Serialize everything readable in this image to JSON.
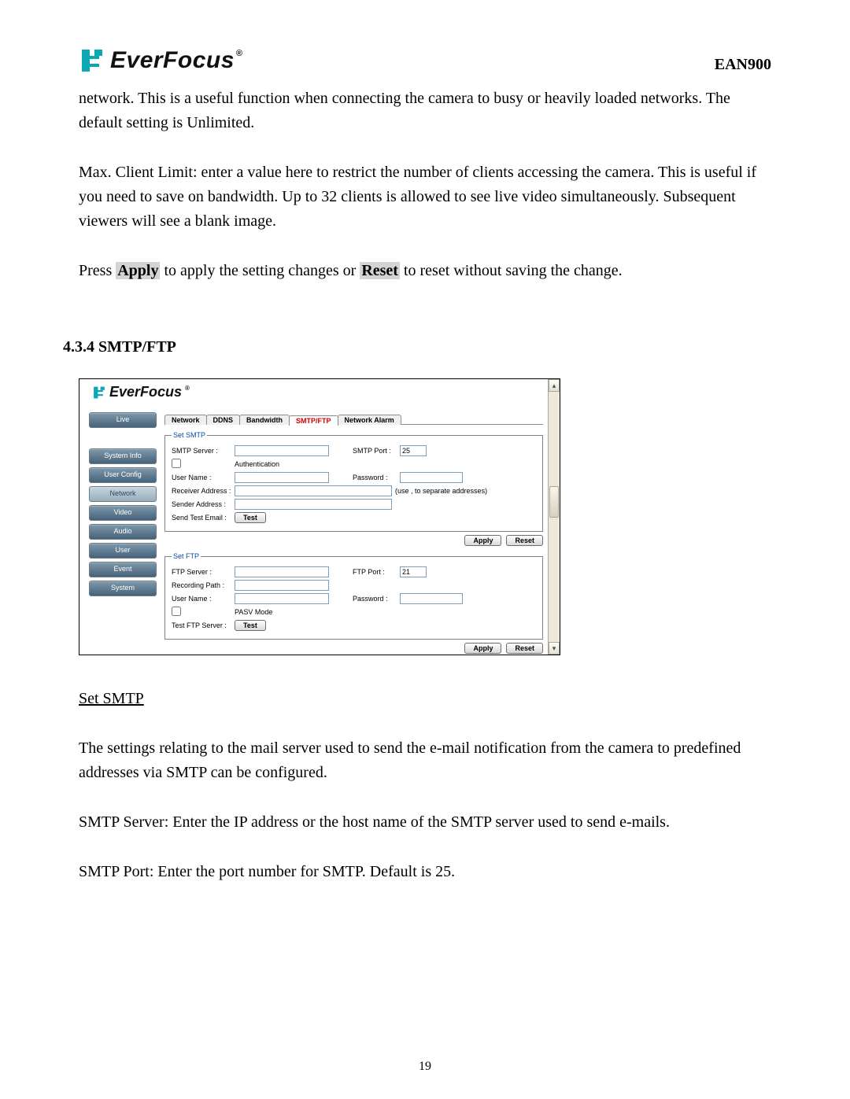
{
  "header": {
    "brand": "EverFocus",
    "model": "EAN900"
  },
  "intro_paragraphs": {
    "p1": "network. This is a useful function when connecting the camera to busy or heavily loaded networks. The default setting is Unlimited.",
    "p2": "Max. Client Limit: enter a value here to restrict the number of clients accessing the camera. This is useful if you need to save on bandwidth. Up to 32 clients is allowed to see live video simultaneously. Subsequent viewers will see a blank image.",
    "p3_a": "Press ",
    "p3_apply": "Apply",
    "p3_b": " to apply the setting changes or ",
    "p3_reset": "Reset",
    "p3_c": " to reset without saving the change."
  },
  "section_heading": "4.3.4 SMTP/FTP",
  "shot": {
    "brand": "EverFocus",
    "sidebar": {
      "live": "Live",
      "items": [
        "System Info",
        "User Config",
        "Network",
        "Video",
        "Audio",
        "User",
        "Event",
        "System"
      ]
    },
    "tabs": [
      "Network",
      "DDNS",
      "Bandwidth",
      "SMTP/FTP",
      "Network Alarm"
    ],
    "active_tab_index": 3,
    "smtp": {
      "legend": "Set SMTP",
      "server_label": "SMTP Server :",
      "port_label": "SMTP Port :",
      "port_value": "25",
      "auth_cb_label": "Authentication",
      "user_label": "User Name :",
      "password_label": "Password :",
      "receiver_label": "Receiver Address :",
      "receiver_hint": "(use , to separate addresses)",
      "sender_label": "Sender Address :",
      "send_test_label": "Send Test Email :",
      "test_btn": "Test",
      "apply": "Apply",
      "reset": "Reset"
    },
    "ftp": {
      "legend": "Set FTP",
      "server_label": "FTP Server :",
      "port_label": "FTP Port :",
      "port_value": "21",
      "record_path_label": "Recording Path :",
      "user_label": "User Name :",
      "password_label": "Password :",
      "pasv_label": "PASV Mode",
      "test_label": "Test FTP Server :",
      "test_btn": "Test",
      "apply": "Apply",
      "reset": "Reset"
    }
  },
  "after_text": {
    "h": "Set SMTP",
    "p1": "The settings relating to the mail server used to send the e-mail notification from the camera to predefined addresses via SMTP can be configured.",
    "p2": "SMTP Server: Enter the IP address or the host name of the SMTP server used to send e-mails.",
    "p3": "SMTP Port: Enter the port number for SMTP. Default is 25."
  },
  "page_number": "19"
}
